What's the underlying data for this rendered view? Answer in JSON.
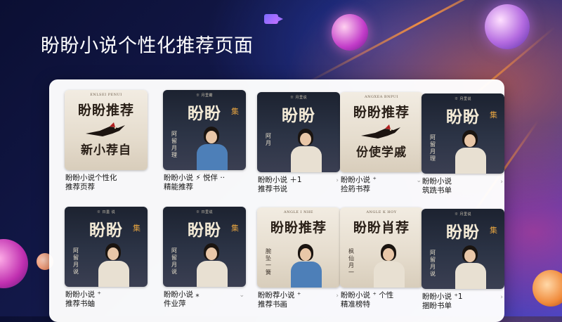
{
  "page": {
    "title": "盼盼小说个性化推荐页面"
  },
  "colors": {
    "panel": "#ffffff",
    "title_text": "#ffffff",
    "background_dark": "#0b0f33",
    "accent_orange": "#ff8a3a",
    "accent_pink": "#e63c8c"
  },
  "books": [
    {
      "cover": {
        "style": "light",
        "small": "ENLSEI PENUI",
        "title": "盼盼推荐",
        "accent": "",
        "sub": "新小荐自",
        "vert": "",
        "art": "bird"
      },
      "line1": "盼盼小说个性化",
      "line2": "推荐页荐",
      "chevron": ""
    },
    {
      "cover": {
        "style": "dark",
        "small": "※ 月里霸",
        "title": "盼盼",
        "accent": "集",
        "sub": "",
        "vert": "阿留月理",
        "art": "boy"
      },
      "line1": "盼盼小说 ⚡ 悦伴 ··",
      "line2": "精能推荐",
      "chevron": ""
    },
    {
      "cover": {
        "style": "dark",
        "small": "※ 月里说",
        "title": "盼盼",
        "accent": "",
        "sub": "",
        "vert": "阿月",
        "art": "girl"
      },
      "line1": "盼盼小说 ＋1",
      "line2": "推荐书说",
      "chevron": "›"
    },
    {
      "cover": {
        "style": "light",
        "small": "ANGXEA BNPUI",
        "title": "盼盼推荐",
        "accent": "",
        "sub": "份使学戚",
        "vert": "",
        "art": "bird"
      },
      "line1": "盼盼小说 ⁺",
      "line2": "捡箹书荐",
      "chevron": "⌄"
    },
    {
      "cover": {
        "style": "dark",
        "small": "※ 月里说",
        "title": "盼盼",
        "accent": "集",
        "sub": "",
        "vert": "阿留月理",
        "art": "girl"
      },
      "line1": "盼盼小说",
      "line2": "筑跣书单",
      "chevron": "›"
    },
    {
      "cover": {
        "style": "dark",
        "small": "※ 日墨 说",
        "title": "盼盼",
        "accent": "集",
        "sub": "",
        "vert": "阿留月说",
        "art": "girl"
      },
      "line1": "盼盼小说 ⁺",
      "line2": "推荐书蚰",
      "chevron": ""
    },
    {
      "cover": {
        "style": "dark",
        "small": "※ 日里说",
        "title": "盼盼",
        "accent": "集",
        "sub": "",
        "vert": "阿留月说",
        "art": "girl"
      },
      "line1": "盼盼小说 ⁎",
      "line2": "件业萍",
      "chevron": "⌄"
    },
    {
      "cover": {
        "style": "light",
        "small": "ANGLE I NHE",
        "title": "盼盼推荐",
        "accent": "",
        "sub": "",
        "vert": "腕坠一簧",
        "art": "boy"
      },
      "line1": "盼盼荐小说 ⁺",
      "line2": "推荐书画",
      "chevron": "›"
    },
    {
      "cover": {
        "style": "light",
        "small": "ANGLE K HOY",
        "title": "盼盼肖荐",
        "accent": "",
        "sub": "",
        "vert": "枫仙月一",
        "art": "girl"
      },
      "line1": "盼盼小说 ⁺ 个性",
      "line2": "精准榜特",
      "chevron": ""
    },
    {
      "cover": {
        "style": "dark",
        "small": "※ 月里说",
        "title": "盼盼",
        "accent": "集",
        "sub": "",
        "vert": "阿留月说",
        "art": "girl"
      },
      "line1": "盼盼小说 ⁺1",
      "line2": "捆盼书单",
      "chevron": "›"
    }
  ]
}
